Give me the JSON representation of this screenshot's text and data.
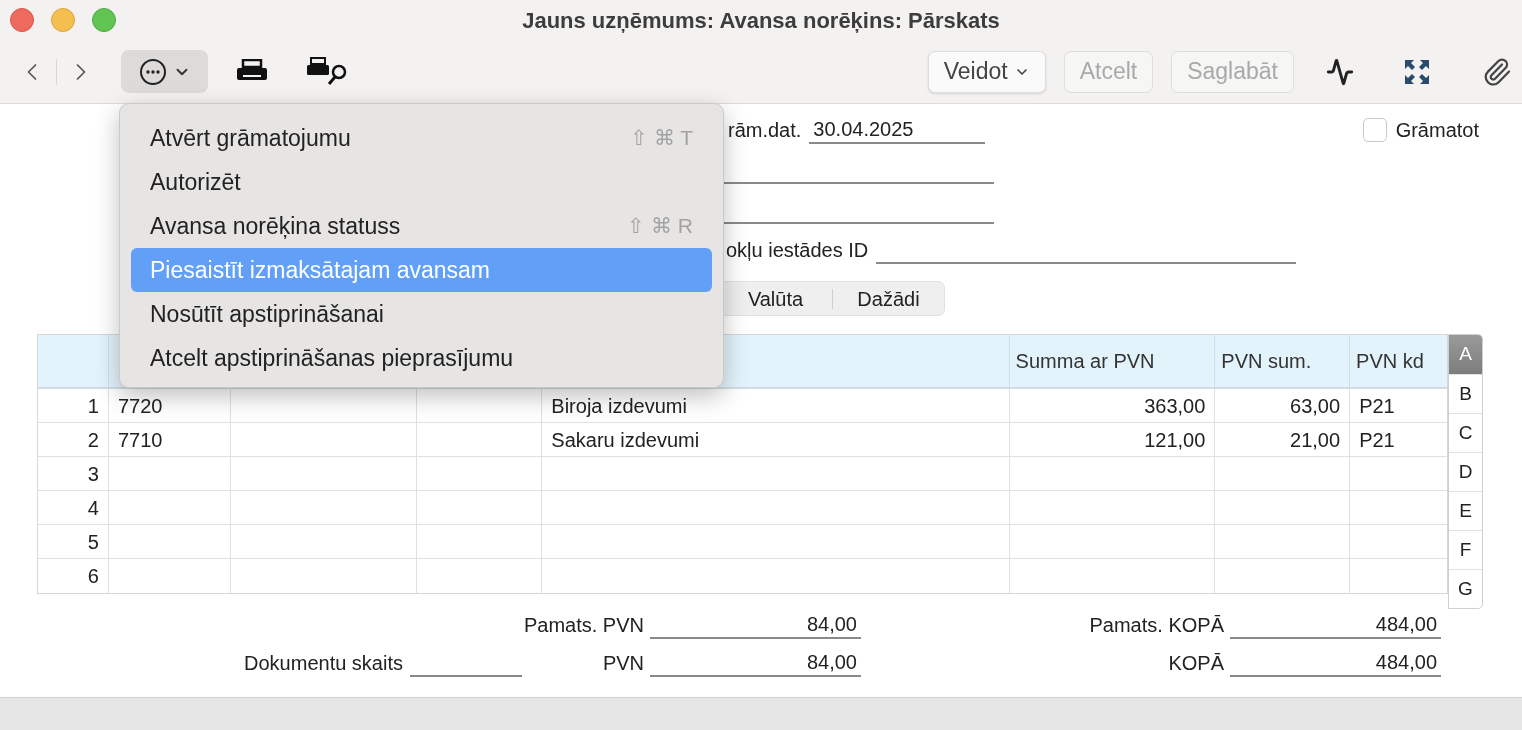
{
  "window": {
    "title": "Jauns uzņēmums: Avansa norēķins: Pārskats"
  },
  "toolbar": {
    "buttons": [
      {
        "label": "Veidot",
        "kind": "dropdown",
        "disabled": false
      },
      {
        "label": "Atcelt",
        "kind": "plain",
        "disabled": true
      },
      {
        "label": "Saglabāt",
        "kind": "plain",
        "disabled": true
      }
    ]
  },
  "menu": {
    "items": [
      {
        "label": "Atvērt grāmatojumu",
        "shortcut": "⇧ ⌘ T",
        "selected": false
      },
      {
        "label": "Autorizēt",
        "selected": false
      },
      {
        "label": "Avansa norēķina statuss",
        "shortcut": "⇧ ⌘ R",
        "selected": false
      },
      {
        "label": "Piesaistīt izmaksātajam avansam",
        "selected": true
      },
      {
        "label": "Nosūtīt apstiprināšanai",
        "selected": false
      },
      {
        "label": "Atcelt apstiprināšanas pieprasījumu",
        "selected": false
      }
    ]
  },
  "form": {
    "fields": [
      {
        "kind": "labeled",
        "label": "rām.dat.",
        "value": "30.04.2025"
      },
      {
        "kind": "line"
      },
      {
        "kind": "line"
      },
      {
        "kind": "wide",
        "label": "okļu iestādes ID"
      }
    ],
    "checkbox": {
      "label": "Grāmatot",
      "checked": false
    }
  },
  "tabs": [
    {
      "label": "Valūta",
      "selected": false
    },
    {
      "label": "Dažādi",
      "selected": false
    }
  ],
  "table": {
    "columns": [
      null,
      null,
      null,
      null,
      null,
      "Summa ar PVN",
      "PVN sum.",
      "PVN kd"
    ],
    "rows": [
      {
        "number": "1",
        "cells": [
          "7720",
          null,
          null,
          "Biroja izdevumi",
          "363,00",
          "63,00",
          "P21"
        ]
      },
      {
        "number": "2",
        "cells": [
          "7710",
          null,
          null,
          "Sakaru izdevumi",
          "121,00",
          "21,00",
          "P21"
        ]
      },
      {
        "number": "3",
        "cells": []
      },
      {
        "number": "4",
        "cells": []
      },
      {
        "number": "5",
        "cells": []
      },
      {
        "number": "6",
        "cells": []
      }
    ]
  },
  "side_tabs": [
    {
      "label": "A",
      "selected": true
    },
    {
      "label": "B",
      "selected": false
    },
    {
      "label": "C",
      "selected": false
    },
    {
      "label": "D",
      "selected": false
    },
    {
      "label": "E",
      "selected": false
    },
    {
      "label": "F",
      "selected": false
    },
    {
      "label": "G",
      "selected": false
    }
  ],
  "totals": {
    "row_1": {
      "base_vat": {
        "label": "Pamats. PVN",
        "value": "84,00"
      },
      "base_total": {
        "label": "Pamats. KOPĀ",
        "value": "484,00"
      }
    },
    "row_2": {
      "document_count": {
        "label": "Dokumentu skaits"
      },
      "vat": {
        "label": "PVN",
        "value": "84,00"
      },
      "total": {
        "label": "KOPĀ",
        "value": "484,00"
      }
    }
  }
}
